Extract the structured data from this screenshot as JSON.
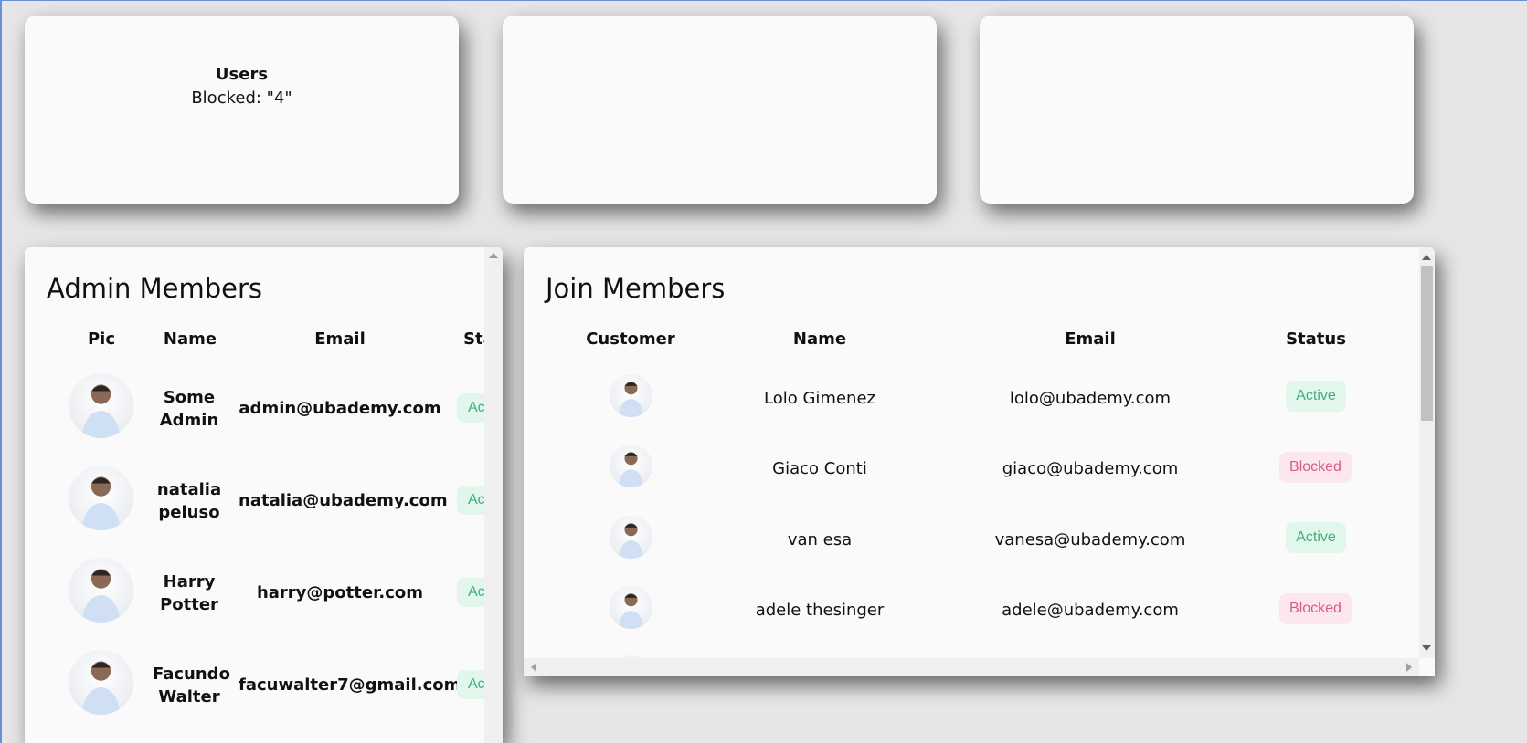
{
  "stats": [
    {
      "title": "Users",
      "line": "Blocked: \"4\""
    },
    {
      "title": "",
      "line": ""
    },
    {
      "title": "",
      "line": ""
    }
  ],
  "admin": {
    "title": "Admin Members",
    "headers": {
      "pic": "Pic",
      "name": "Name",
      "email": "Email",
      "status": "Status"
    },
    "rows": [
      {
        "name": "Some Admin",
        "email": "admin@ubademy.com",
        "status": "Active"
      },
      {
        "name": "natalia peluso",
        "email": "natalia@ubademy.com",
        "status": "Active"
      },
      {
        "name": "Harry Potter",
        "email": "harry@potter.com",
        "status": "Active"
      },
      {
        "name": "Facundo Walter",
        "email": "facuwalter7@gmail.com",
        "status": "Active"
      }
    ]
  },
  "join": {
    "title": "Join Members",
    "headers": {
      "customer": "Customer",
      "name": "Name",
      "email": "Email",
      "status": "Status"
    },
    "rows": [
      {
        "name": "Lolo Gimenez",
        "email": "lolo@ubademy.com",
        "status": "Active"
      },
      {
        "name": "Giaco Conti",
        "email": "giaco@ubademy.com",
        "status": "Blocked"
      },
      {
        "name": "van esa",
        "email": "vanesa@ubademy.com",
        "status": "Active"
      },
      {
        "name": "adele thesinger",
        "email": "adele@ubademy.com",
        "status": "Blocked"
      }
    ]
  },
  "colors": {
    "active_bg": "#e3f6ec",
    "active_text": "#3fb07a",
    "blocked_bg": "#fde7ee",
    "blocked_text": "#d65c8a"
  }
}
